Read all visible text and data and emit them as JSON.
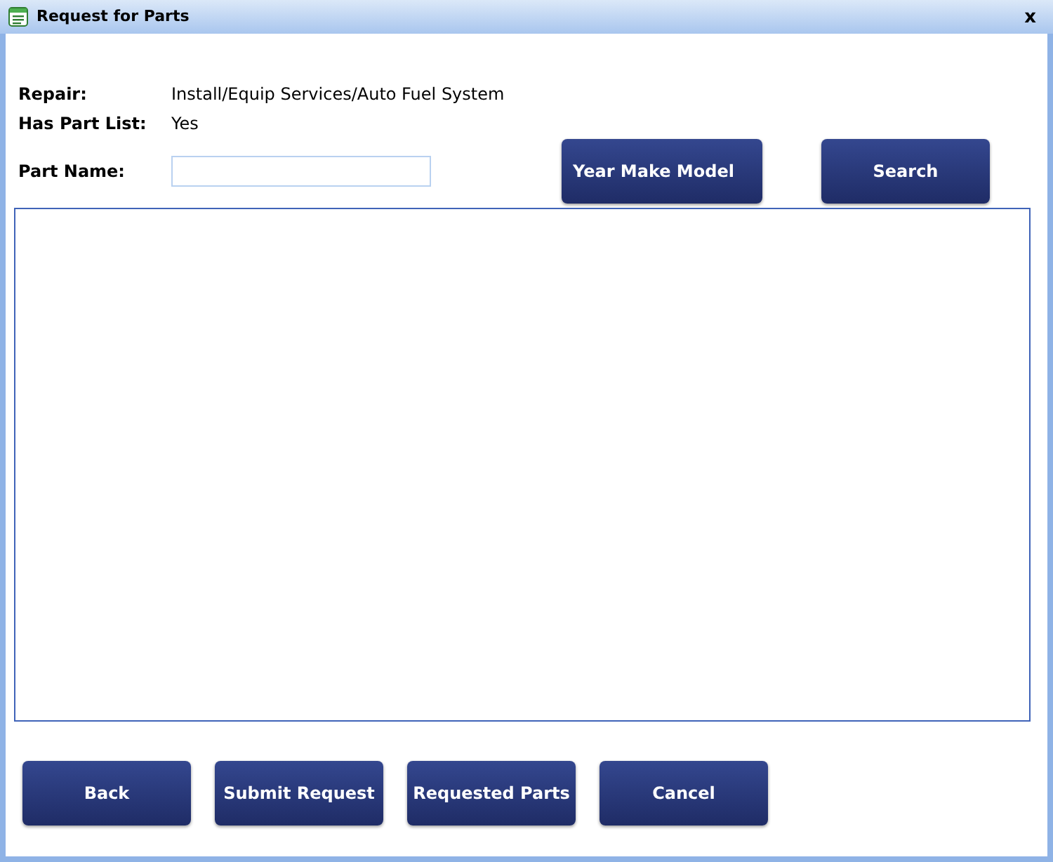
{
  "window": {
    "title": "Request for Parts",
    "close": "x"
  },
  "fields": [
    {
      "label": "Repair:",
      "value": "Install/Equip Services/Auto Fuel System"
    },
    {
      "label": "Has Part List:",
      "value": "Yes"
    }
  ],
  "part_name": {
    "label": "Part Name:"
  },
  "search_buttons": [
    "Year Make Model",
    "Search"
  ],
  "buttons": [
    "Back",
    "Submit Request",
    "Requested Parts",
    "Cancel"
  ]
}
